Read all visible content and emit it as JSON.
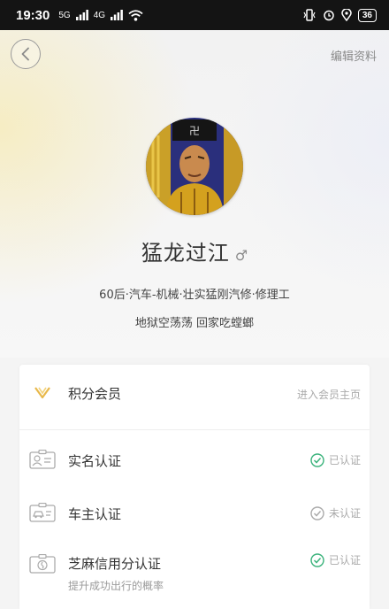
{
  "status_bar": {
    "time": "19:30",
    "signal_1": "5G",
    "signal_2": "4G",
    "battery": "36"
  },
  "header": {
    "edit_label": "编辑资料"
  },
  "profile": {
    "name": "猛龙过江",
    "gender_symbol": "♂",
    "tags": "60后·汽车-机械·壮实猛刚汽修·修理工",
    "motto": "地狱空荡荡 回家吃螳螂"
  },
  "list": {
    "member": {
      "label": "积分会员",
      "action": "进入会员主页"
    },
    "realname": {
      "label": "实名认证",
      "status": "已认证"
    },
    "car_owner": {
      "label": "车主认证",
      "status": "未认证"
    },
    "sesame": {
      "label": "芝麻信用分认证",
      "status": "已认证",
      "subtitle": "提升成功出行的概率"
    }
  },
  "colors": {
    "verified": "#39b27a",
    "unverified": "#aaaaaa",
    "member_mark": "#e8b84a"
  }
}
